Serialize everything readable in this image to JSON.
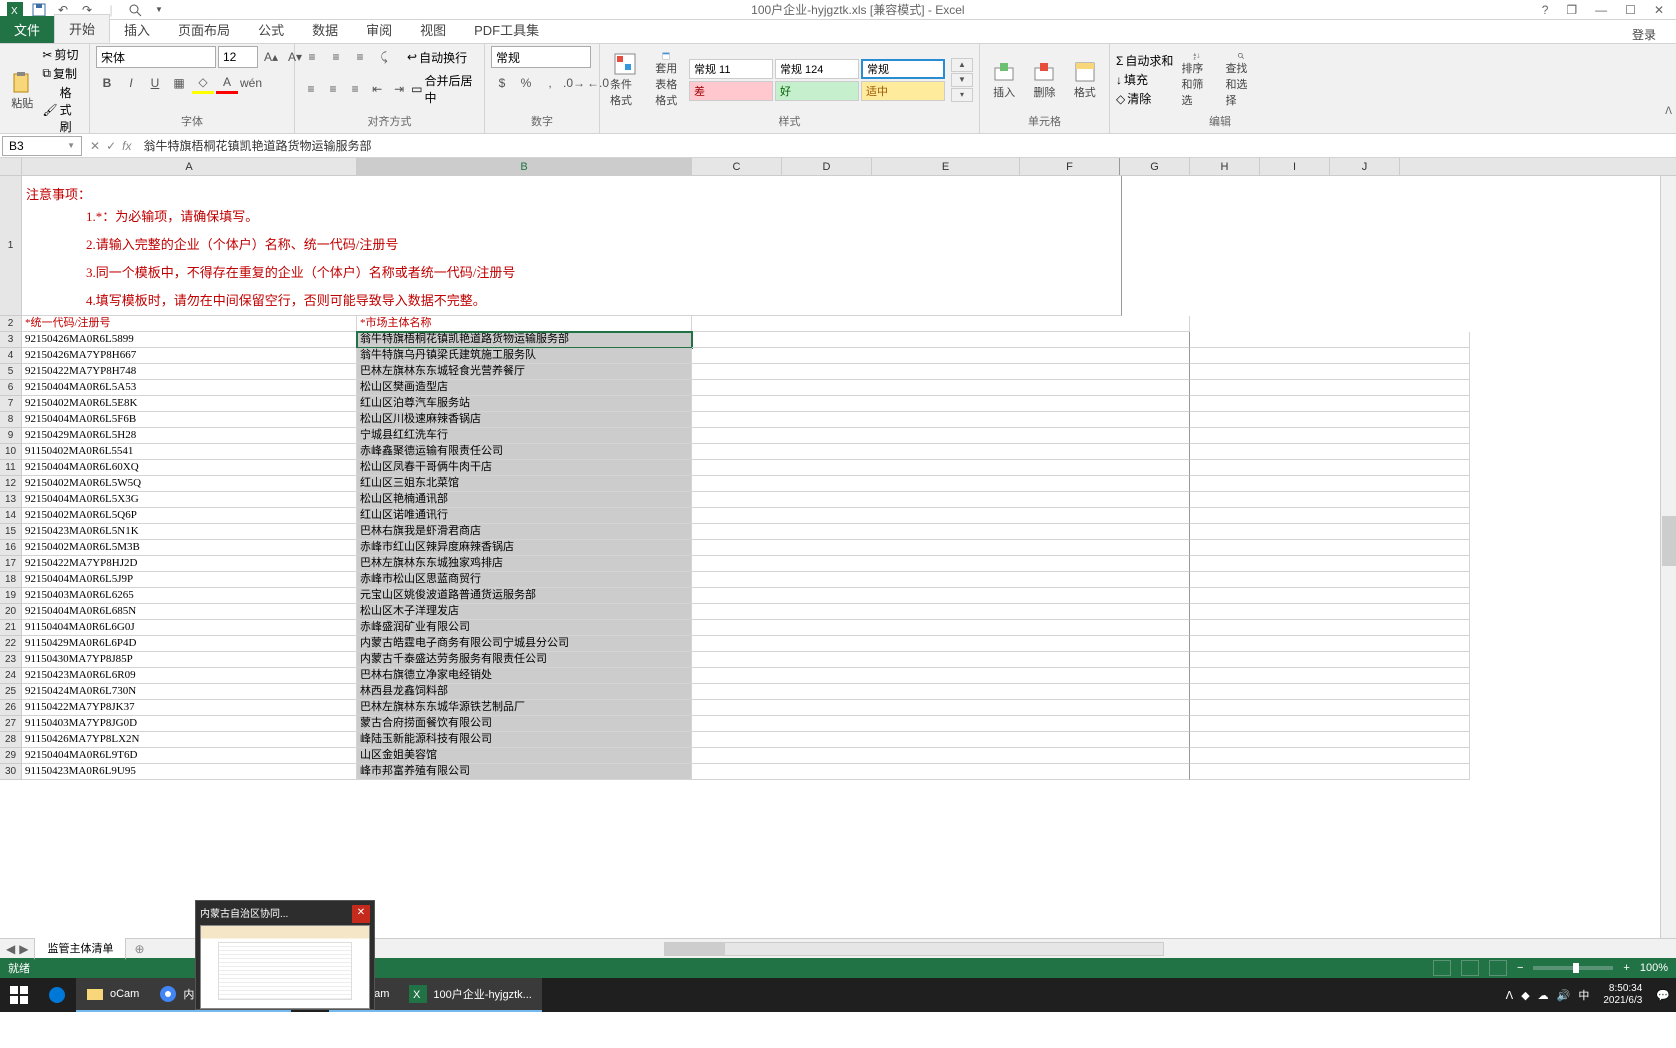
{
  "title": "100户企业-hyjgztk.xls [兼容模式] - Excel",
  "qat": {
    "save": "save-icon",
    "undo": "undo-icon",
    "redo": "redo-icon",
    "print_preview": "print-preview-icon"
  },
  "win": {
    "help": "?",
    "restore": "❐",
    "min": "—",
    "max": "☐",
    "close": "✕"
  },
  "login_label": "登录",
  "tabs": [
    "文件",
    "开始",
    "插入",
    "页面布局",
    "公式",
    "数据",
    "审阅",
    "视图",
    "PDF工具集"
  ],
  "active_tab": "开始",
  "ribbon": {
    "clipboard": {
      "paste": "粘贴",
      "cut": "剪切",
      "copy": "复制",
      "format_painter": "格式刷",
      "label": "剪贴板"
    },
    "font": {
      "name": "宋体",
      "size": "12",
      "label": "字体"
    },
    "align": {
      "wrap": "自动换行",
      "merge": "合并后居中",
      "label": "对齐方式"
    },
    "number": {
      "format": "常规",
      "label": "数字"
    },
    "styles": {
      "cond_format": "条件格式",
      "table_format": "套用\n表格格式",
      "box1": "常规 11",
      "box2": "常规 124",
      "box3": "常规",
      "box4": "差",
      "box5": "好",
      "box6": "适中",
      "label": "样式"
    },
    "cells": {
      "insert": "插入",
      "delete": "删除",
      "format": "格式",
      "label": "单元格"
    },
    "editing": {
      "autosum": "自动求和",
      "fill": "填充",
      "clear": "清除",
      "sort": "排序和筛选",
      "find": "查找和选择",
      "label": "编辑"
    }
  },
  "name_box": "B3",
  "formula": "翁牛特旗梧桐花镇凯艳道路货物运输服务部",
  "columns": [
    "A",
    "B",
    "C",
    "D",
    "E",
    "F",
    "G",
    "H",
    "I",
    "J"
  ],
  "instructions": {
    "title": "注意事项：",
    "lines": [
      "1.*：为必输项，请确保填写。",
      "2.请输入完整的企业（个体户）名称、统一代码/注册号",
      "3.同一个模板中，不得存在重复的企业（个体户）名称或者统一代码/注册号",
      "4.填写模板时，请勿在中间保留空行，否则可能导致导入数据不完整。"
    ]
  },
  "header_row": {
    "a": "*统一代码/注册号",
    "b": "*市场主体名称"
  },
  "rows": [
    {
      "n": 3,
      "a": "92150426MA0R6L5899",
      "b": "翁牛特旗梧桐花镇凯艳道路货物运输服务部"
    },
    {
      "n": 4,
      "a": "92150426MA7YP8H667",
      "b": "翁牛特旗乌丹镇梁氏建筑施工服务队"
    },
    {
      "n": 5,
      "a": "92150422MA7YP8H748",
      "b": "巴林左旗林东东城轻食光营养餐厅"
    },
    {
      "n": 6,
      "a": "92150404MA0R6L5A53",
      "b": "松山区樊画造型店"
    },
    {
      "n": 7,
      "a": "92150402MA0R6L5E8K",
      "b": "红山区泊尊汽车服务站"
    },
    {
      "n": 8,
      "a": "92150404MA0R6L5F6B",
      "b": "松山区川极速麻辣香锅店"
    },
    {
      "n": 9,
      "a": "92150429MA0R6L5H28",
      "b": "宁城县红红洗车行"
    },
    {
      "n": 10,
      "a": "91150402MA0R6L5541",
      "b": "赤峰鑫聚德运输有限责任公司"
    },
    {
      "n": 11,
      "a": "92150404MA0R6L60XQ",
      "b": "松山区凤春干哥俩牛肉干店"
    },
    {
      "n": 12,
      "a": "92150402MA0R6L5W5Q",
      "b": "红山区三姐东北菜馆"
    },
    {
      "n": 13,
      "a": "92150404MA0R6L5X3G",
      "b": "松山区艳楠通讯部"
    },
    {
      "n": 14,
      "a": "92150402MA0R6L5Q6P",
      "b": "红山区诺唯通讯行"
    },
    {
      "n": 15,
      "a": "92150423MA0R6L5N1K",
      "b": "巴林右旗我是虾滑君商店"
    },
    {
      "n": 16,
      "a": "92150402MA0R6L5M3B",
      "b": "赤峰市红山区辣异度麻辣香锅店"
    },
    {
      "n": 17,
      "a": "92150422MA7YP8HJ2D",
      "b": "巴林左旗林东东城独家鸡排店"
    },
    {
      "n": 18,
      "a": "92150404MA0R6L5J9P",
      "b": "赤峰市松山区思蓝商贸行"
    },
    {
      "n": 19,
      "a": "92150403MA0R6L6265",
      "b": "元宝山区姚俊波道路普通货运服务部"
    },
    {
      "n": 20,
      "a": "92150404MA0R6L685N",
      "b": "松山区木子洋理发店"
    },
    {
      "n": 21,
      "a": "91150404MA0R6L6G0J",
      "b": "赤峰盛润矿业有限公司"
    },
    {
      "n": 22,
      "a": "91150429MA0R6L6P4D",
      "b": "内蒙古皓霆电子商务有限公司宁城县分公司"
    },
    {
      "n": 23,
      "a": "91150430MA7YP8J85P",
      "b": "内蒙古千泰盛达劳务服务有限责任公司"
    },
    {
      "n": 24,
      "a": "92150423MA0R6L6R09",
      "b": "巴林右旗德立净家电经销处"
    },
    {
      "n": 25,
      "a": "92150424MA0R6L730N",
      "b": "林西县龙鑫饲料部"
    },
    {
      "n": 26,
      "a": "91150422MA7YP8JK37",
      "b": "巴林左旗林东东城华源铁艺制品厂"
    },
    {
      "n": 27,
      "a": "91150403MA7YP8JG0D",
      "b": "蒙古合府捞面餐饮有限公司"
    },
    {
      "n": 28,
      "a": "91150426MA7YP8LX2N",
      "b": "峰陆玉新能源科技有限公司"
    },
    {
      "n": 29,
      "a": "92150404MA0R6L9T6D",
      "b": "山区金姐美容馆"
    },
    {
      "n": 30,
      "a": "91150423MA0R6L9U95",
      "b": "峰市邦富养殖有限公司"
    }
  ],
  "sheet_tab": "监管主体清单",
  "status": "就绪",
  "zoom": "100%",
  "taskbar": {
    "items": [
      {
        "id": "start",
        "label": ""
      },
      {
        "id": "edge",
        "label": ""
      },
      {
        "id": "explorer",
        "label": "oCam"
      },
      {
        "id": "chrome",
        "label": "内蒙古自治区协同..."
      },
      {
        "id": "app1",
        "label": ""
      },
      {
        "id": "ocam",
        "label": "ocam"
      },
      {
        "id": "excel",
        "label": "100户企业-hyjgztk..."
      }
    ],
    "clock_time": "8:50:34",
    "clock_date": "2021/6/3"
  },
  "thumb_title": "内蒙古自治区协同..."
}
